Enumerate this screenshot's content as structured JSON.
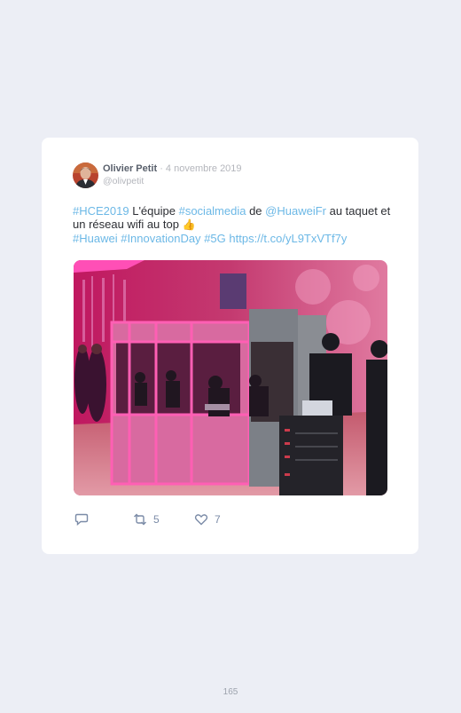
{
  "tweet": {
    "author_name": "Olivier Petit",
    "separator": " · ",
    "date": "4 novembre 2019",
    "handle": "@olivpetit",
    "text": {
      "hashtag_hce": "#HCE2019",
      "t1": " L'équipe ",
      "hashtag_socialmedia": "#socialmedia",
      "t2": " de ",
      "mention_huawei": "@HuaweiFr",
      "t3": " au taquet et un réseau wifi au top ",
      "emoji": "👍",
      "hashtag_huawei": "#Huawei",
      "hashtag_innovation": "#InnovationDay",
      "hashtag_5g": "#5G",
      "url": "https://t.co/yL9TxVTf7y"
    },
    "actions": {
      "reply_icon": "reply-icon",
      "retweet_icon": "retweet-icon",
      "retweet_count": "5",
      "like_icon": "heart-icon",
      "like_count": "7"
    }
  },
  "page_number": "165",
  "colors": {
    "background": "#eceef5",
    "card": "#ffffff",
    "link": "#6cb8e6",
    "author": "#59606c",
    "meta": "#b4b6bc",
    "action": "#7b8ba7"
  }
}
